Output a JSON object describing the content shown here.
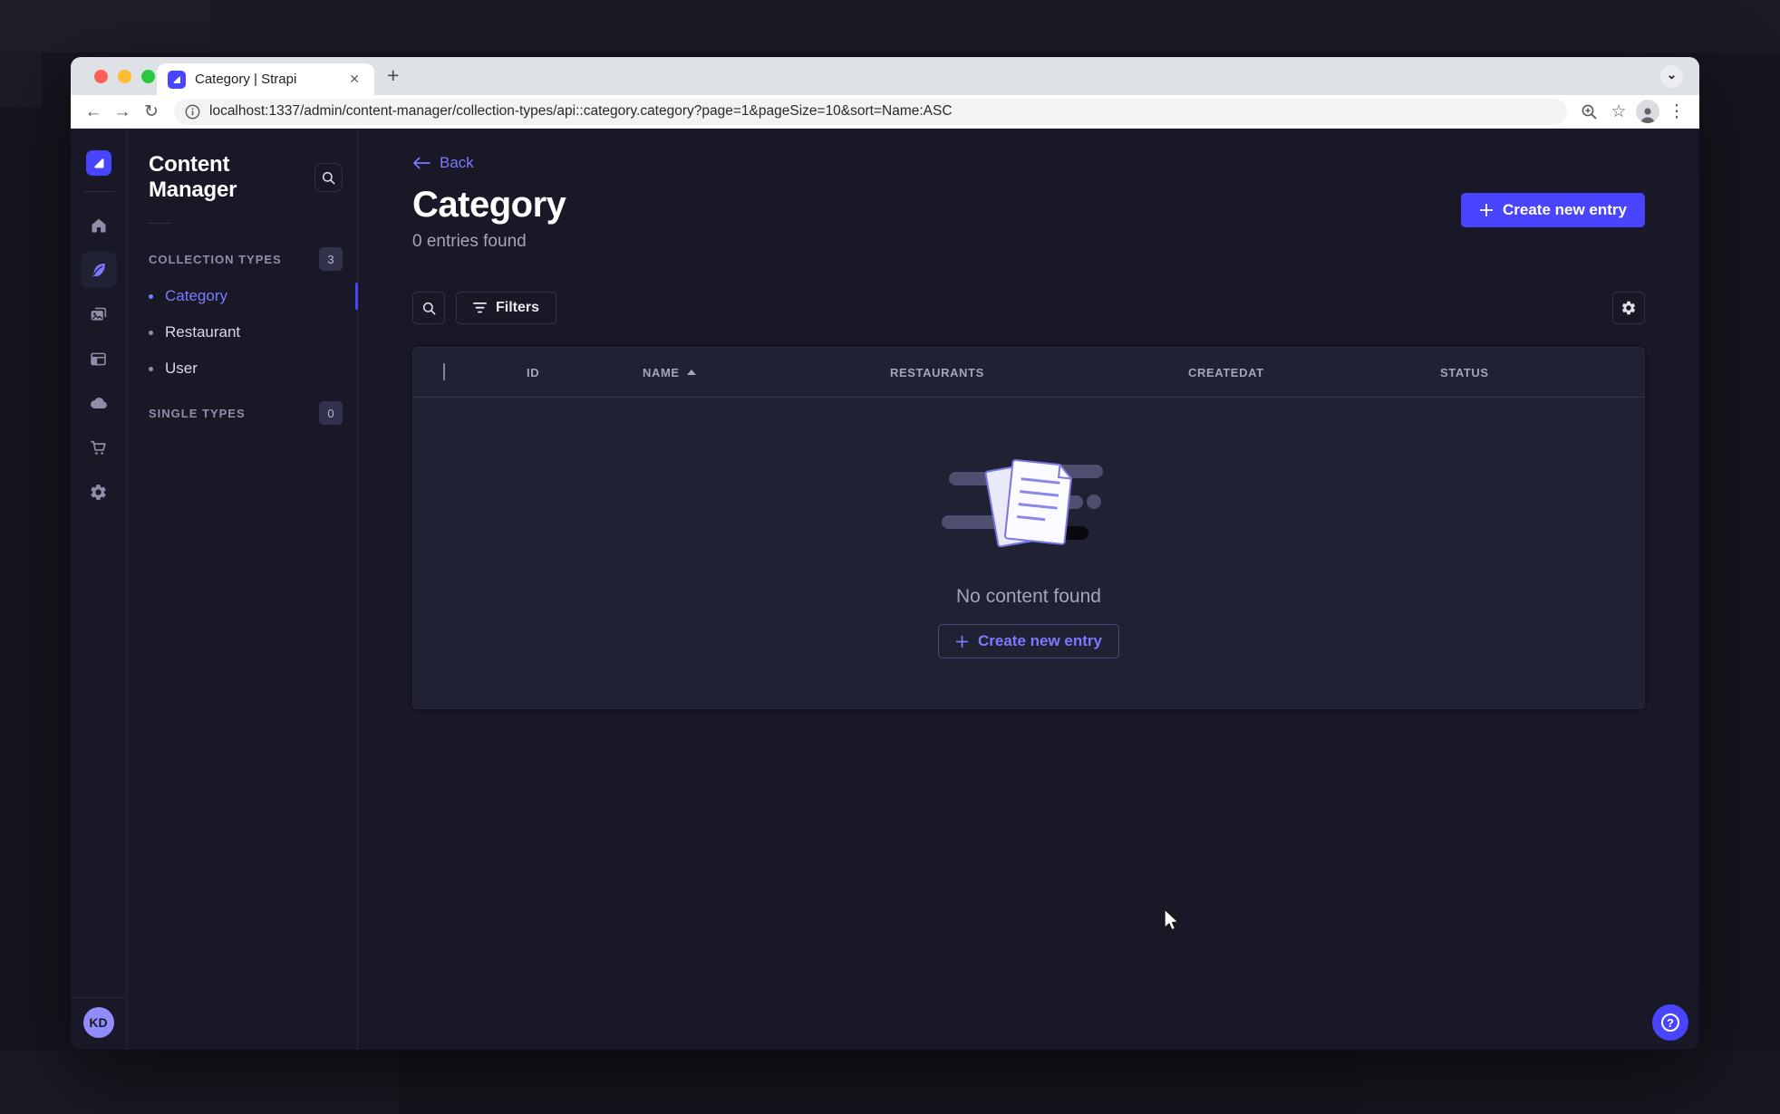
{
  "browser": {
    "tab_title": "Category | Strapi",
    "new_tab": "+",
    "url": "localhost:1337/admin/content-manager/collection-types/api::category.category?page=1&pageSize=10&sort=Name:ASC"
  },
  "icons": {
    "back_arrow": "←",
    "forward_arrow": "→",
    "reload": "↻",
    "star": "☆",
    "kebab": "⋮",
    "chevron_down": "⌄",
    "close": "✕",
    "question": "?"
  },
  "navbar": {
    "avatar_initials": "KD"
  },
  "subnav": {
    "title": "Content Manager",
    "collection_types": {
      "label": "COLLECTION TYPES",
      "count": "3",
      "items": [
        {
          "label": "Category",
          "active": true
        },
        {
          "label": "Restaurant",
          "active": false
        },
        {
          "label": "User",
          "active": false
        }
      ]
    },
    "single_types": {
      "label": "SINGLE TYPES",
      "count": "0"
    }
  },
  "page": {
    "back": "Back",
    "title": "Category",
    "subtitle": "0 entries found",
    "create_button": "Create new entry",
    "filters_button": "Filters"
  },
  "table": {
    "headers": [
      "ID",
      "NAME",
      "RESTAURANTS",
      "CREATEDAT",
      "STATUS"
    ],
    "sort": {
      "column": "NAME",
      "direction": "ASC"
    },
    "empty_message": "No content found",
    "empty_cta": "Create new entry"
  },
  "colors": {
    "primary": "#4945ff",
    "primary_light": "#7b79ff",
    "app_bg": "#181826",
    "card_bg": "#212134",
    "border": "#32324d",
    "text_muted": "#a5a5ba",
    "chrome_bg": "#dee1e6",
    "avatar_bg": "#908cfa"
  }
}
